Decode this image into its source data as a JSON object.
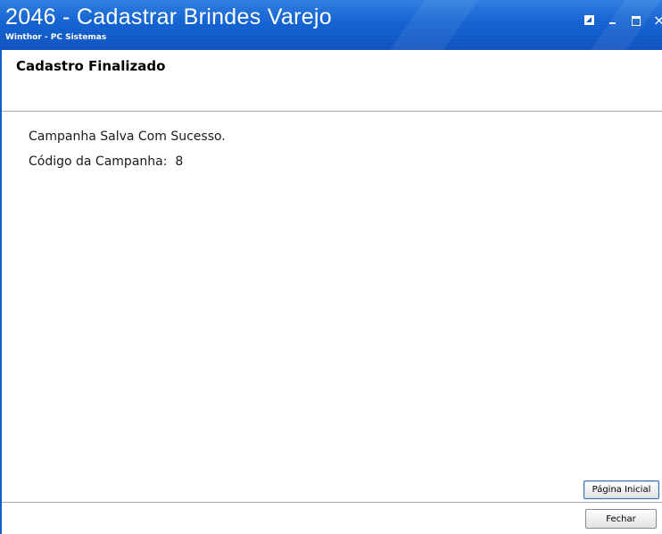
{
  "window": {
    "title": "2046 - Cadastrar Brindes Varejo",
    "subtitle": "Winthor - PC Sistemas",
    "close_glyph": "×",
    "accent_color": "#0e5fd0"
  },
  "header": {
    "section_title": "Cadastro Finalizado"
  },
  "main": {
    "success_message": "Campanha Salva Com Sucesso.",
    "campaign_code_text": "Código da Campanha:  8"
  },
  "buttons": {
    "home_label": "Página Inicial",
    "close_label": "Fechar"
  },
  "icons": [
    "restore-icon",
    "minimize-icon",
    "maximize-icon",
    "close-icon"
  ]
}
